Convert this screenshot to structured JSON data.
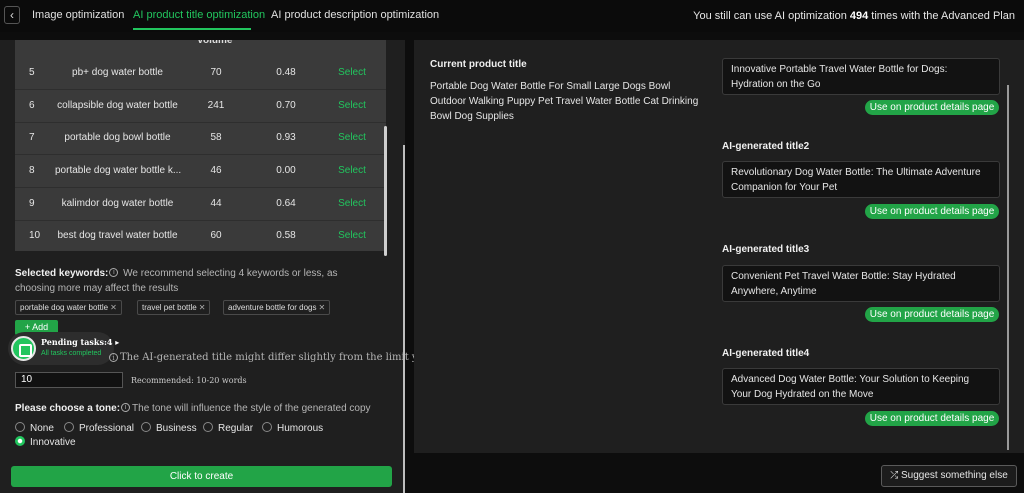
{
  "tabs": [
    {
      "label": "Image optimization"
    },
    {
      "label": "AI product title optimization"
    },
    {
      "label": "AI product description optimization"
    }
  ],
  "quota": {
    "prefix": "You still can use AI optimization",
    "count": "494",
    "suffix": "times with the Advanced Plan"
  },
  "table": {
    "header_partial": "volume",
    "rows": [
      {
        "idx": "5",
        "keyword": "pb+ dog water bottle",
        "volume": "70",
        "score": "0.48",
        "action": "Select"
      },
      {
        "idx": "6",
        "keyword": "collapsible dog water bottle",
        "volume": "241",
        "score": "0.70",
        "action": "Select"
      },
      {
        "idx": "7",
        "keyword": "portable dog bowl bottle",
        "volume": "58",
        "score": "0.93",
        "action": "Select"
      },
      {
        "idx": "8",
        "keyword": "portable dog water bottle k...",
        "volume": "46",
        "score": "0.00",
        "action": "Select"
      },
      {
        "idx": "9",
        "keyword": "kalimdor dog water bottle",
        "volume": "44",
        "score": "0.64",
        "action": "Select"
      },
      {
        "idx": "10",
        "keyword": "best dog travel water bottle",
        "volume": "60",
        "score": "0.58",
        "action": "Select"
      }
    ]
  },
  "selected_keywords": {
    "label": "Selected keywords:",
    "hint": "We recommend selecting 4 keywords or less, as choosing more may affect the results",
    "chips": [
      "portable dog water bottle",
      "travel pet bottle",
      "adventure bottle for dogs"
    ],
    "add_label": "Add"
  },
  "pending": {
    "title": "Pending tasks:4",
    "subtitle": "All tasks completed"
  },
  "word_limit": {
    "note": "The AI-generated title might differ slightly from the limit you set",
    "value": "10",
    "recommended": "Recommended: 10-20 words"
  },
  "tone": {
    "label": "Please choose a tone:",
    "hint": "The tone will influence the style of the generated copy",
    "options": [
      "None",
      "Professional",
      "Business",
      "Regular",
      "Humorous",
      "Innovative"
    ],
    "selected": "Innovative"
  },
  "create_label": "Click to create",
  "current": {
    "label": "Current product title",
    "text": "Portable Dog Water Bottle For Small Large Dogs Bowl Outdoor Walking Puppy Pet Travel Water Bottle Cat Drinking Bowl Dog Supplies"
  },
  "ai_titles": [
    {
      "label": "",
      "text": "Innovative Portable Travel Water Bottle for Dogs: Hydration on the Go"
    },
    {
      "label": "AI-generated title2",
      "text": "Revolutionary Dog Water Bottle: The Ultimate Adventure Companion for Your Pet"
    },
    {
      "label": "AI-generated title3",
      "text": "Convenient Pet Travel Water Bottle: Stay Hydrated Anywhere, Anytime"
    },
    {
      "label": "AI-generated title4",
      "text": "Advanced Dog Water Bottle: Your Solution to Keeping Your Dog Hydrated on the Move"
    }
  ],
  "use_label": "Use on product details page",
  "suggest_label": "Suggest something else",
  "colors": {
    "accent": "#22c55e",
    "button": "#22a447",
    "panel": "#1f1f1f",
    "background": "#0d0d0d"
  }
}
